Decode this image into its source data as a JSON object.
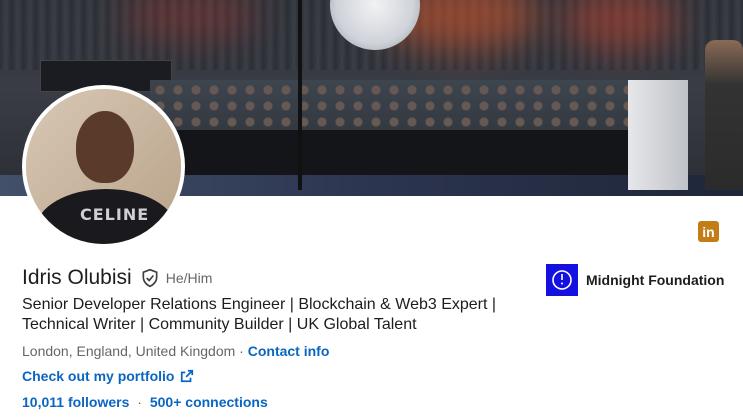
{
  "profile": {
    "name": "Idris Olubisi",
    "pronouns": "He/Him",
    "headline": "Senior Developer Relations Engineer | Blockchain & Web3 Expert | Technical Writer | Community Builder | UK Global Talent",
    "location": "London, England, United Kingdom",
    "location_separator": "·",
    "contact_label": "Contact info",
    "portfolio_label": "Check out my portfolio",
    "followers": "10,011 followers",
    "stats_separator": "·",
    "connections": "500+ connections",
    "avatar_shirt_text": "CELINE"
  },
  "company": {
    "name": "Midnight Foundation",
    "logo_color": "#1410e0"
  },
  "linkedin_badge": {
    "glyph": "in",
    "color": "#c37d16"
  },
  "colors": {
    "link": "#0a66c2",
    "muted": "#666666",
    "text": "#1d1d1d"
  },
  "icons": [
    "verified-shield-icon",
    "external-link-icon",
    "linkedin-icon",
    "company-logo-icon"
  ]
}
